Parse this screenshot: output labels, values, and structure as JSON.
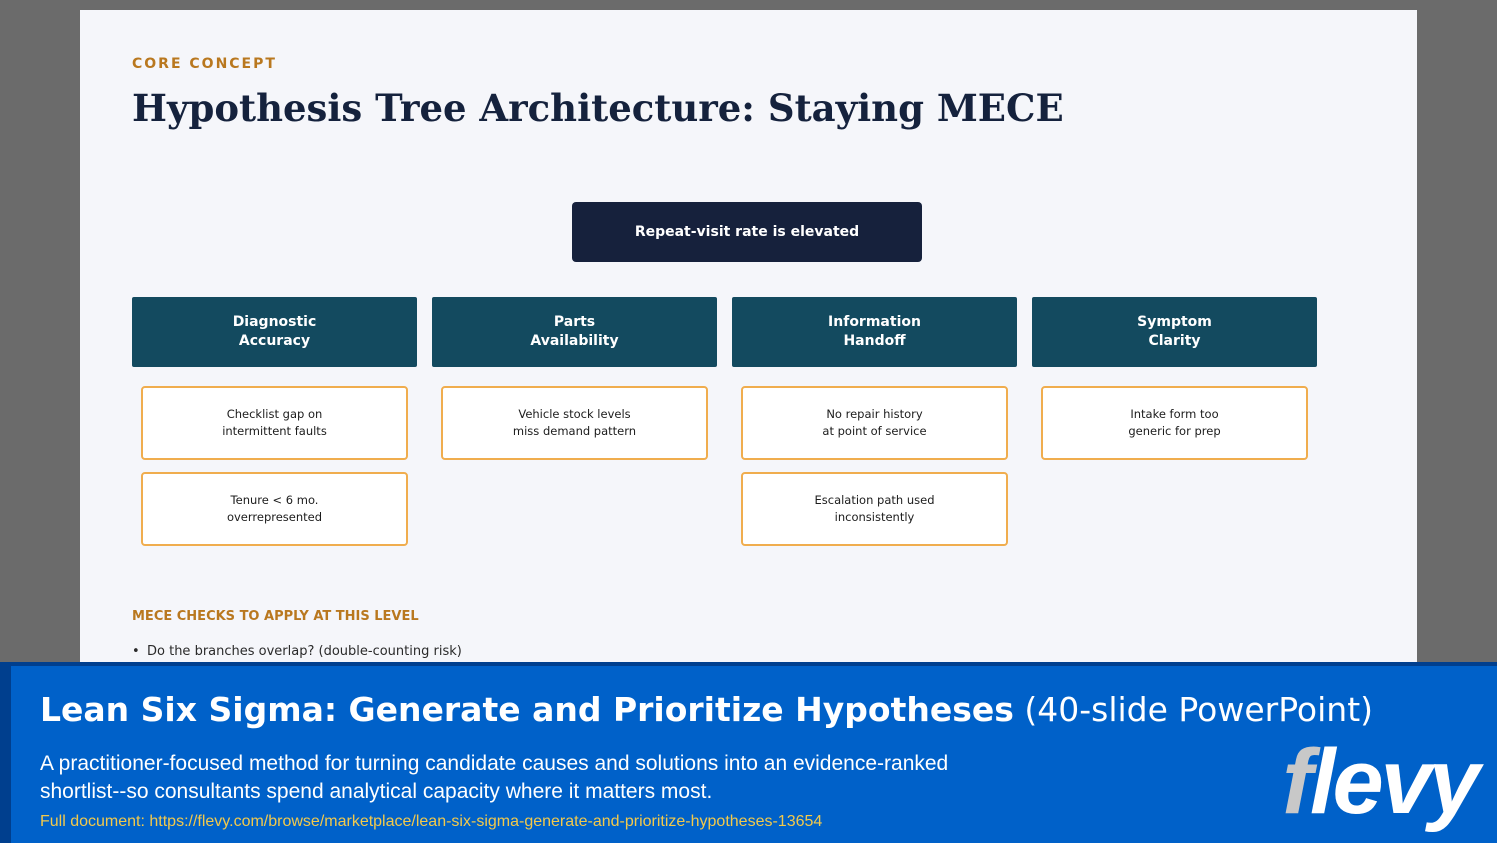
{
  "slide": {
    "eyebrow": "CORE CONCEPT",
    "title": "Hypothesis Tree Architecture: Staying MECE",
    "root": "Repeat-visit rate is elevated",
    "branches": [
      {
        "label": "Diagnostic\nAccuracy",
        "leaves": [
          "Checklist gap on\nintermittent faults",
          "Tenure < 6 mo.\noverrepresented"
        ]
      },
      {
        "label": "Parts\nAvailability",
        "leaves": [
          "Vehicle stock levels\nmiss demand pattern"
        ]
      },
      {
        "label": "Information\nHandoff",
        "leaves": [
          "No repair history\nat point of service",
          "Escalation path used\ninconsistently"
        ]
      },
      {
        "label": "Symptom\nClarity",
        "leaves": [
          "Intake form too\ngeneric for prep"
        ]
      }
    ],
    "checks_heading": "MECE CHECKS TO APPLY AT THIS LEVEL",
    "checks": [
      "Do the branches overlap? (double-counting risk)"
    ]
  },
  "banner": {
    "title_strong": "Lean Six Sigma: Generate and Prioritize Hypotheses",
    "title_light": " (40-slide PowerPoint)",
    "description": "A practitioner-focused method for turning candidate causes and solutions into an evidence-ranked shortlist--so consultants spend analytical capacity where it matters most.",
    "link": "Full document: https://flevy.com/browse/marketplace/lean-six-sigma-generate-and-prioritize-hypotheses-13654",
    "logo_first": "f",
    "logo_rest": "levy"
  },
  "colors": {
    "accent": "#b9781f",
    "root_bg": "#16213c",
    "branch_bg": "#134a5f",
    "leaf_border": "#f0ad4e",
    "banner_bg": "#0061c9"
  }
}
